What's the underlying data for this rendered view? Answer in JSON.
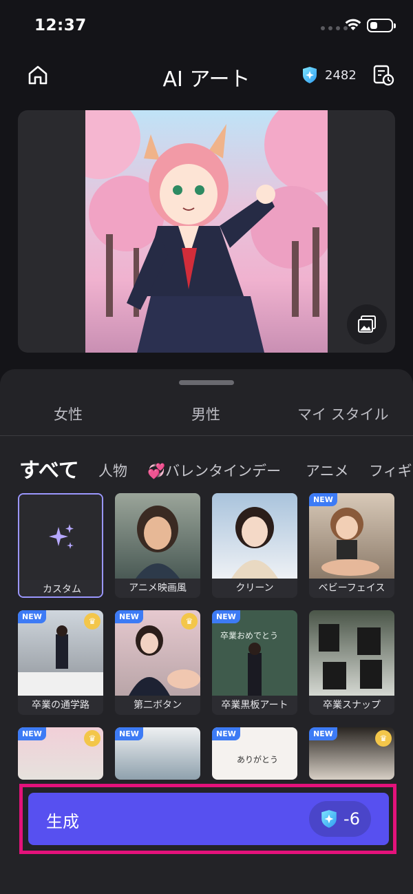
{
  "status": {
    "time": "12:37"
  },
  "header": {
    "title": "AI アート",
    "credits": "2482"
  },
  "gender_tabs": [
    "女性",
    "男性",
    "マイ スタイル"
  ],
  "categories": {
    "active": "すべて",
    "c1": "人物",
    "c2": "💞バレンタインデー",
    "c3": "アニメ",
    "c4": "フィギ"
  },
  "tiles": {
    "t1": "カスタム",
    "t2": "アニメ映画風",
    "t3": "クリーン",
    "t4": "ベビーフェイス",
    "t5": "卒業の通学路",
    "t6": "第二ボタン",
    "t7": "卒業黒板アート",
    "t8": "卒業スナップ",
    "new": "NEW"
  },
  "tile_texts": {
    "chalkboard": "卒業おめでとう",
    "thanks": "ありがとう"
  },
  "generate": {
    "label": "生成",
    "cost": "-6"
  },
  "colors": {
    "accent": "#5750f0",
    "highlight": "#e4127b",
    "new_badge": "#3d7bf5",
    "crown": "#f3c64a"
  }
}
